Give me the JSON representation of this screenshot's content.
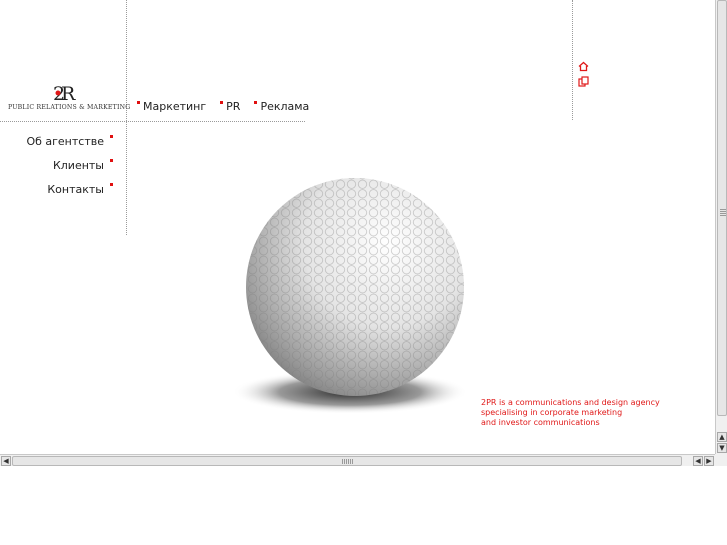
{
  "logo": {
    "mark": "2R",
    "tagline": "PUBLIC RELATIONS & MARKETING"
  },
  "topnav": {
    "items": [
      {
        "label": "Маркетинг"
      },
      {
        "label": "PR"
      },
      {
        "label": "Реклама"
      }
    ]
  },
  "sidenav": {
    "items": [
      {
        "label": "Об агентстве"
      },
      {
        "label": "Клиенты"
      },
      {
        "label": "Контакты"
      }
    ]
  },
  "tagline": {
    "line1": "2PR is a communications and design agency",
    "line2": "specialising in corporate marketing",
    "line3": "and investor communications"
  },
  "icons": {
    "home": "home-icon",
    "copy": "copy-icon"
  },
  "colors": {
    "accent": "#e01818",
    "dot": "#e01010"
  }
}
